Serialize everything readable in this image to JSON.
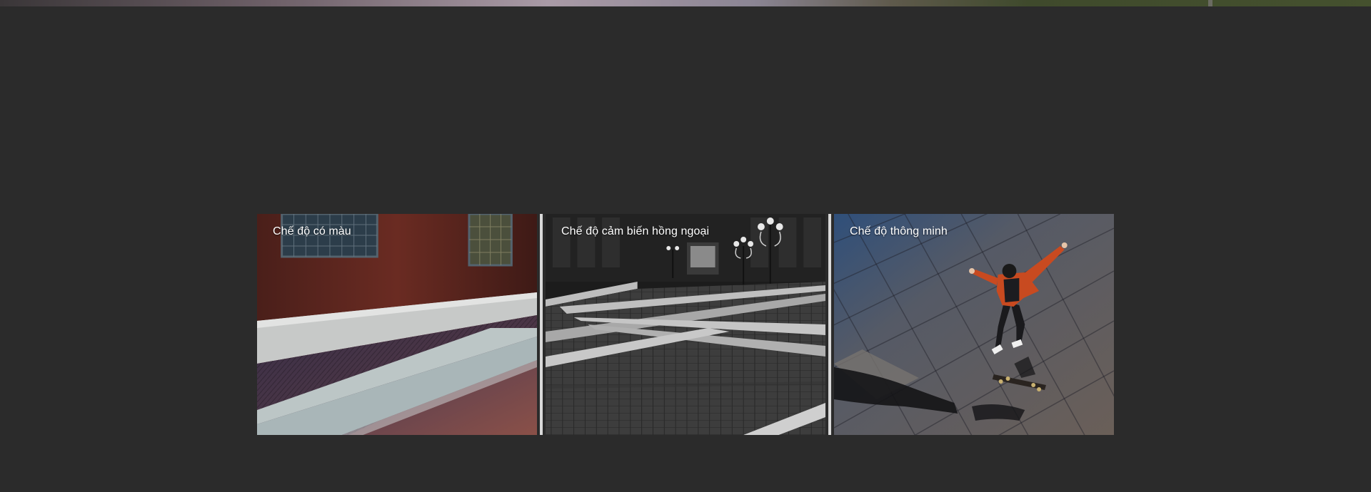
{
  "modes": [
    {
      "label": "Chế độ có màu",
      "icon": "color-mode-image"
    },
    {
      "label": "Chế độ cảm biến hồng ngoại",
      "icon": "infrared-mode-image"
    },
    {
      "label": "Chế độ thông minh",
      "icon": "smart-mode-image"
    }
  ],
  "colors": {
    "page_background": "#2b2b2b",
    "label_text": "#ffffff"
  }
}
